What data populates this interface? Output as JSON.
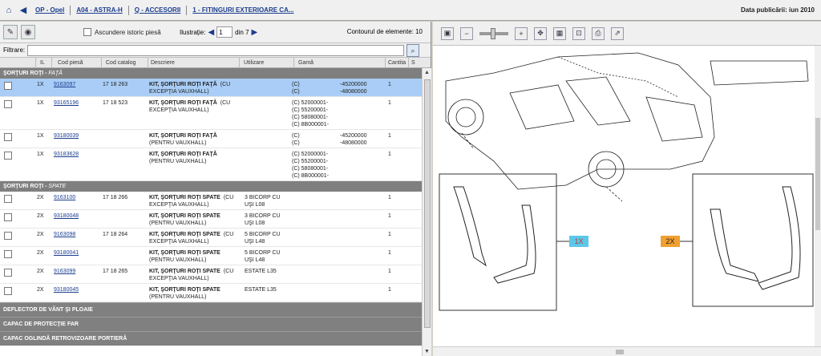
{
  "top": {
    "breadcrumb": [
      "OP - Opel",
      "A04 - ASTRA-H",
      "Q - ACCESORII",
      "1 - FITINGURI EXTERIOARE CA..."
    ],
    "pubdate": "Data publicării: iun 2010"
  },
  "left_toolbar": {
    "history_label": "Ascundere istoric piesă",
    "illustration_label": "Ilustrație:",
    "illustration_value": "1",
    "illustration_of": "din 7",
    "contour": "Contourul de elemente: 10"
  },
  "filter": {
    "label": "Filtrare:"
  },
  "columns": [
    "IL",
    "Cod piesă",
    "Cod catalog",
    "Descriere",
    "Utilizare",
    "Gamă",
    "Cantita",
    "S"
  ],
  "groups": [
    {
      "title": "ŞORŢURI ROŢI -",
      "subtitle": "FAŢĂ",
      "rows": [
        {
          "il": "1X",
          "code": "9163097",
          "catalog": "17 18 263",
          "desc": "KIT, ŞORŢURI ROŢI FAŢĂ",
          "desc_tail": "(CU",
          "desc2": "EXCEPŢIA VAUXHALL)",
          "use": "",
          "use2": "",
          "gama": [
            "(C)",
            "(C)"
          ],
          "gama2": [
            "-45200000",
            "-48080000"
          ],
          "qty": "1",
          "selected": true
        },
        {
          "il": "1X",
          "code": "93165196",
          "catalog": "17 18 523",
          "desc": "KIT, ŞORŢURI ROŢI FAŢĂ",
          "desc_tail": "(CU",
          "desc2": "EXCEPŢIA VAUXHALL)",
          "use": "",
          "use2": "",
          "gama": [
            "(C) 52000001-",
            "(C) 55200001-",
            "(C) 58080001-",
            "(C) 8B000001-"
          ],
          "gama2": [],
          "qty": "1",
          "selected": false
        },
        {
          "il": "1X",
          "code": "93180039",
          "catalog": "",
          "desc": "KIT, ŞORŢURI ROŢI FAŢĂ",
          "desc_tail": "",
          "desc2": "(PENTRU VAUXHALL)",
          "use": "",
          "use2": "",
          "gama": [
            "(C)",
            "(C)"
          ],
          "gama2": [
            "-45200000",
            "-48080000"
          ],
          "qty": "1",
          "selected": false
        },
        {
          "il": "1X",
          "code": "93183628",
          "catalog": "",
          "desc": "KIT, ŞORŢURI ROŢI FAŢĂ",
          "desc_tail": "",
          "desc2": "(PENTRU VAUXHALL)",
          "use": "",
          "use2": "",
          "gama": [
            "(C) 52000001-",
            "(C) 55200001-",
            "(C) 58080001-",
            "(C) 8B000001-"
          ],
          "gama2": [],
          "qty": "1",
          "selected": false
        }
      ]
    },
    {
      "title": "ŞORŢURI ROŢI -",
      "subtitle": "SPATE",
      "rows": [
        {
          "il": "2X",
          "code": "9163100",
          "catalog": "17 18 266",
          "desc": "KIT, ŞORŢURI ROŢI SPATE",
          "desc_tail": "(CU",
          "desc2": "EXCEPŢIA VAUXHALL)",
          "use": "3 BICORP CU",
          "use2": "UŞI L08",
          "gama": [],
          "gama2": [],
          "qty": "1",
          "selected": false
        },
        {
          "il": "2X",
          "code": "93180048",
          "catalog": "",
          "desc": "KIT, ŞORŢURI ROŢI SPATE",
          "desc_tail": "",
          "desc2": "(PENTRU VAUXHALL)",
          "use": "3 BICORP CU",
          "use2": "UŞI L08",
          "gama": [],
          "gama2": [],
          "qty": "1",
          "selected": false
        },
        {
          "il": "2X",
          "code": "9163098",
          "catalog": "17 18 264",
          "desc": "KIT, ŞORŢURI ROŢI SPATE",
          "desc_tail": "(CU",
          "desc2": "EXCEPŢIA VAUXHALL)",
          "use": "5 BICORP CU",
          "use2": "UŞI L48",
          "gama": [],
          "gama2": [],
          "qty": "1",
          "selected": false
        },
        {
          "il": "2X",
          "code": "93180041",
          "catalog": "",
          "desc": "KIT, ŞORŢURI ROŢI SPATE",
          "desc_tail": "",
          "desc2": "(PENTRU VAUXHALL)",
          "use": "5 BICORP CU",
          "use2": "UŞI L48",
          "gama": [],
          "gama2": [],
          "qty": "1",
          "selected": false
        },
        {
          "il": "2X",
          "code": "9163099",
          "catalog": "17 18 265",
          "desc": "KIT, ŞORŢURI ROŢI SPATE",
          "desc_tail": "(CU",
          "desc2": "EXCEPŢIA VAUXHALL)",
          "use": "ESTATE L35",
          "use2": "",
          "gama": [],
          "gama2": [],
          "qty": "1",
          "selected": false
        },
        {
          "il": "2X",
          "code": "93180045",
          "catalog": "",
          "desc": "KIT, ŞORŢURI ROŢI SPATE",
          "desc_tail": "",
          "desc2": "(PENTRU VAUXHALL)",
          "use": "ESTATE L35",
          "use2": "",
          "gama": [],
          "gama2": [],
          "qty": "1",
          "selected": false
        }
      ]
    }
  ],
  "collapsed_groups": [
    "DEFLECTOR DE VÂNT ŞI PLOAIE",
    "CAPAC DE PROTECŢIE FAR",
    "CAPAC OGLINDĂ RETROVIZOARE PORTIERĂ"
  ],
  "diagram": {
    "callout_front": "1X",
    "callout_rear": "2X",
    "callout_front_color": "#5bc8e8",
    "callout_rear_color": "#f0a030"
  },
  "accent": "#1a3d8f",
  "selected_row_color": "#a9cdf6"
}
